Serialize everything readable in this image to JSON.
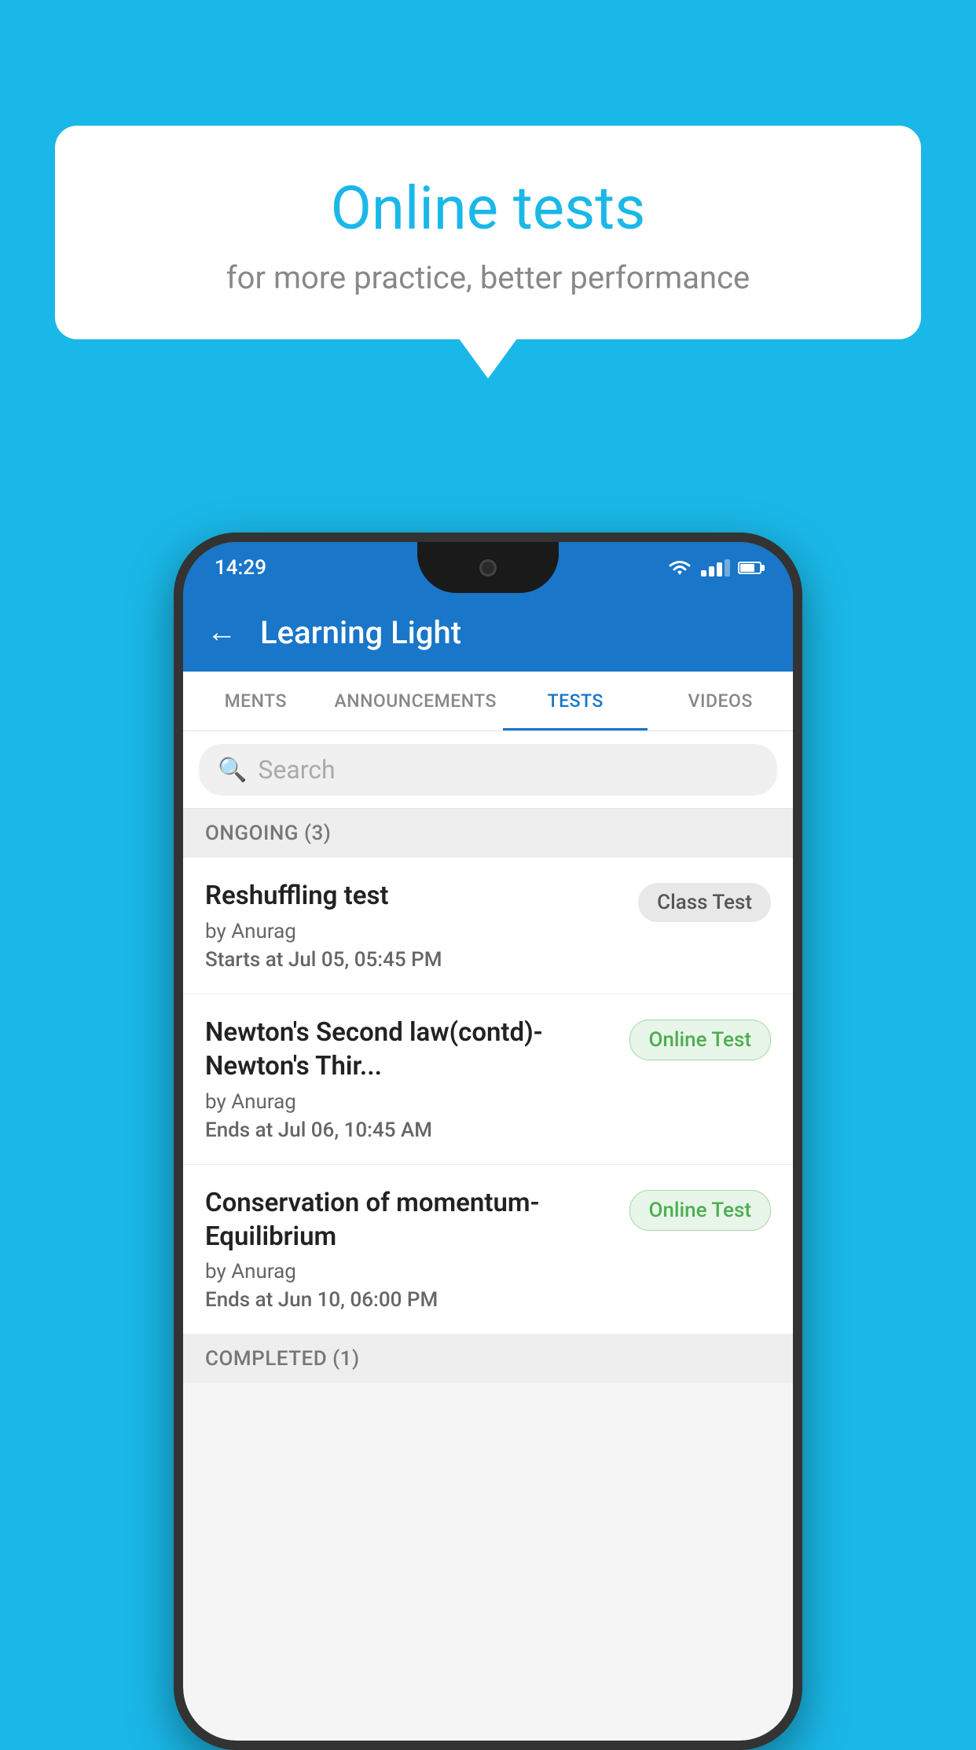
{
  "background_color": "#1ab8e8",
  "speech_bubble": {
    "title": "Online tests",
    "subtitle": "for more practice, better performance"
  },
  "phone": {
    "status_bar": {
      "time": "14:29"
    },
    "app_header": {
      "title": "Learning Light"
    },
    "tabs": [
      {
        "id": "ments",
        "label": "MENTS",
        "active": false
      },
      {
        "id": "announcements",
        "label": "ANNOUNCEMENTS",
        "active": false
      },
      {
        "id": "tests",
        "label": "TESTS",
        "active": true
      },
      {
        "id": "videos",
        "label": "VIDEOS",
        "active": false
      }
    ],
    "search": {
      "placeholder": "Search"
    },
    "ongoing_section": {
      "title": "ONGOING (3)",
      "tests": [
        {
          "id": 1,
          "name": "Reshuffling test",
          "author": "by Anurag",
          "time_label": "Starts at",
          "time_value": "Jul 05, 05:45 PM",
          "badge": "Class Test",
          "badge_type": "class"
        },
        {
          "id": 2,
          "name": "Newton's Second law(contd)-Newton's Thir...",
          "author": "by Anurag",
          "time_label": "Ends at",
          "time_value": "Jul 06, 10:45 AM",
          "badge": "Online Test",
          "badge_type": "online"
        },
        {
          "id": 3,
          "name": "Conservation of momentum-Equilibrium",
          "author": "by Anurag",
          "time_label": "Ends at",
          "time_value": "Jun 10, 06:00 PM",
          "badge": "Online Test",
          "badge_type": "online"
        }
      ]
    },
    "completed_section": {
      "title": "COMPLETED (1)"
    }
  }
}
